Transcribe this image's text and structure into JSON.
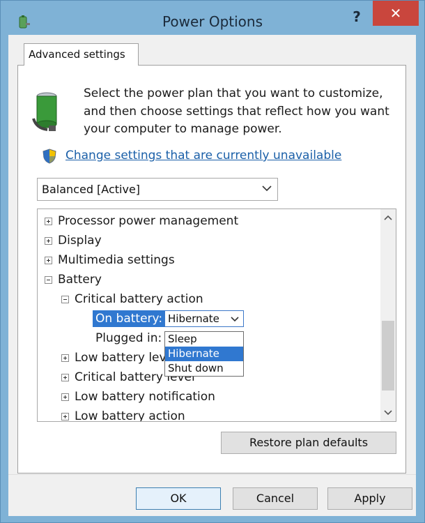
{
  "window": {
    "title": "Power Options",
    "help_label": "?",
    "close_label": "✕"
  },
  "tab": {
    "label": "Advanced settings"
  },
  "intro": {
    "line1": "Select the power plan that you want to customize,",
    "line2": "and then choose settings that reflect how you want",
    "line3": "your computer to manage power."
  },
  "change_link": "Change settings that are currently unavailable",
  "plan_select": {
    "value": "Balanced [Active]"
  },
  "tree": {
    "items": [
      "Processor power management",
      "Display",
      "Multimedia settings",
      "Battery",
      "Critical battery action",
      "Low battery lev",
      "Critical battery level",
      "Low battery notification",
      "Low battery action"
    ],
    "on_battery_label": "On battery:",
    "on_battery_value": "Hibernate",
    "plugged_in_label": "Plugged in:",
    "dropdown_options": [
      "Sleep",
      "Hibernate",
      "Shut down"
    ],
    "dropdown_selected": "Hibernate"
  },
  "buttons": {
    "restore": "Restore plan defaults",
    "ok": "OK",
    "cancel": "Cancel",
    "apply": "Apply"
  },
  "colors": {
    "titlebar": "#7fb2d6",
    "close": "#c9463d",
    "selection": "#3078d0",
    "link": "#1a5fa8"
  },
  "icons": [
    "power-options-app-icon",
    "battery-plug-icon",
    "uac-shield-icon",
    "chevron-down-icon",
    "scroll-up-icon",
    "scroll-down-icon"
  ]
}
